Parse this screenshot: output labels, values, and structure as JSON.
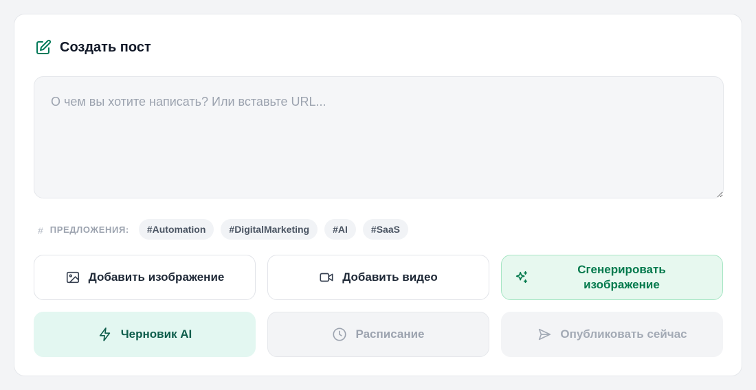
{
  "header": {
    "title": "Создать пост",
    "icon": "edit-icon"
  },
  "composer": {
    "placeholder": "О чем вы хотите написать? Или вставьте URL...",
    "value": ""
  },
  "suggestions": {
    "icon": "#",
    "label": "ПРЕДЛОЖЕНИЯ:",
    "tags": [
      "#Automation",
      "#DigitalMarketing",
      "#AI",
      "#SaaS"
    ]
  },
  "actions": {
    "add_image": "Добавить изображение",
    "add_video": "Добавить видео",
    "generate_image_line1": "Сгенерировать",
    "generate_image_line2": "изображение",
    "ai_draft": "Черновик AI",
    "schedule": "Расписание",
    "publish_now": "Опубликовать сейчас"
  },
  "colors": {
    "accent": "#047a4d",
    "accent_bg": "#e7f8ef",
    "teal_bg": "#e3f7f1",
    "disabled_text": "#9ca3af"
  }
}
